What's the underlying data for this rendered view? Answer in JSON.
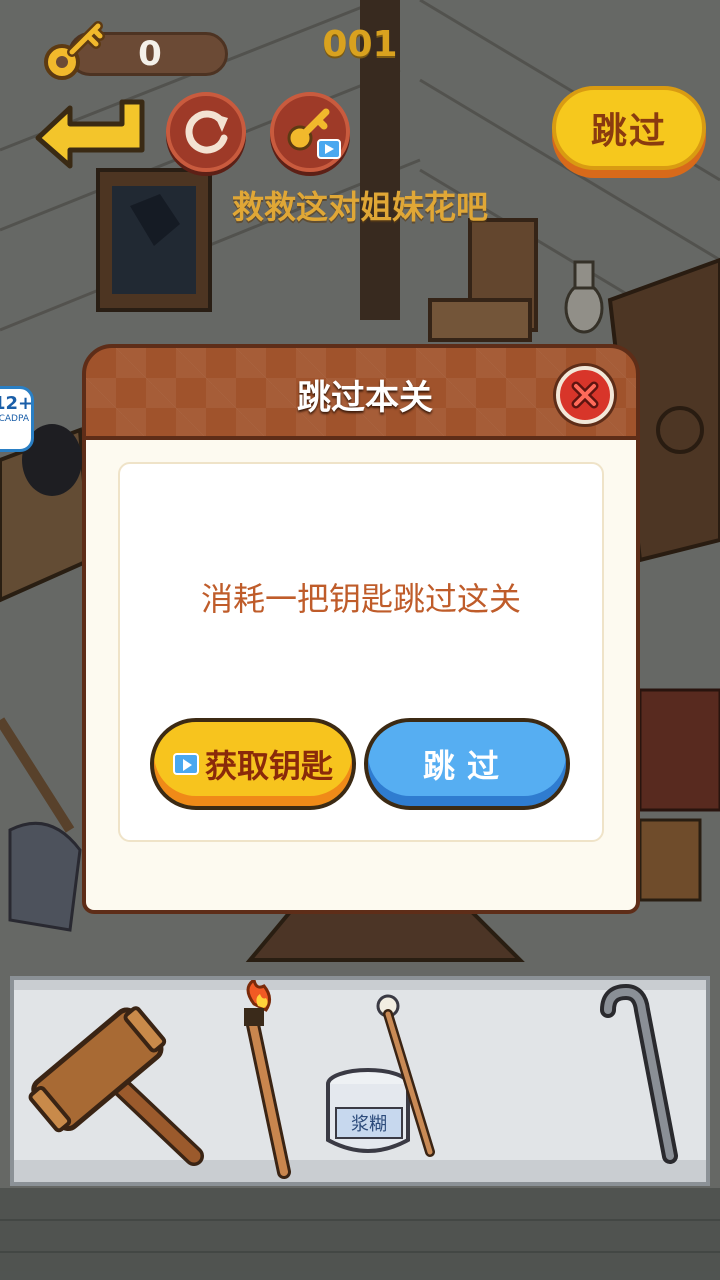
{
  "hud": {
    "key_count": "0",
    "level_number": "001",
    "skip_top_label": "跳过",
    "hint_text": "救救这对姐妹花吧",
    "age_rating": "12+",
    "age_rating_sub": "CADPA"
  },
  "modal": {
    "title": "跳过本关",
    "message": "消耗一把钥匙跳过这关",
    "get_key_label": "获取钥匙",
    "skip_label": "跳过"
  },
  "inventory": {
    "items": [
      "hammer",
      "torch",
      "paste-jar",
      "needle",
      "crowbar"
    ],
    "paste_jar_label": "浆糊"
  },
  "colors": {
    "accent_yellow": "#f6c81d",
    "accent_blue": "#56aef2",
    "modal_brown": "#a0532c",
    "message_orange": "#bf5c2a"
  }
}
